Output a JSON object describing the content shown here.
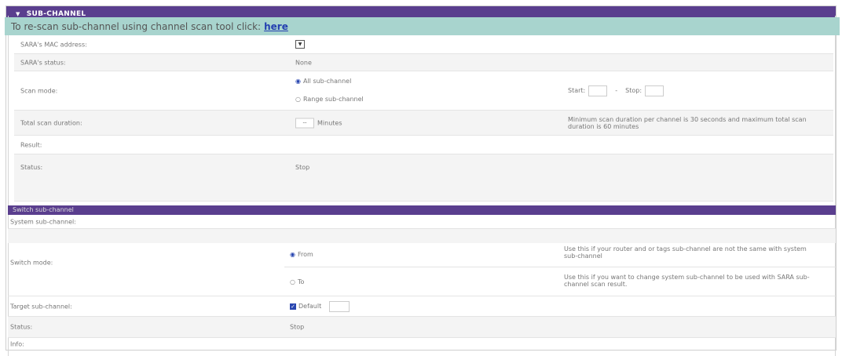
{
  "header": {
    "title": "SUB-CHANNEL"
  },
  "notice": {
    "text": "To re-scan sub-channel using channel scan tool click:",
    "link": "here"
  },
  "scan": {
    "mac_label": "SARA's MAC address:",
    "status_label": "SARA's status:",
    "status_value": "None",
    "mode_label": "Scan mode:",
    "mode_all": "All sub-channel",
    "mode_range": "Range sub-channel",
    "start_label": "Start:",
    "range_sep": "-",
    "stop_label": "Stop:",
    "duration_label": "Total scan duration:",
    "duration_value": "--",
    "duration_unit": "Minutes",
    "duration_note": "Minimum scan duration per channel is 30 seconds and maximum total scan duration is 60 minutes",
    "result_label": "Result:",
    "status2_label": "Status:",
    "status2_value": "Stop"
  },
  "switch": {
    "title": "Switch sub-channel",
    "system_label": "System sub-channel:",
    "mode_label": "Switch mode:",
    "from_label": "From",
    "from_note": "Use this if your router and or tags sub-channel are not the same with system sub-channel",
    "to_label": "To",
    "to_note": "Use this if you want to change system sub-channel to be used with SARA sub-channel scan result.",
    "target_label": "Target sub-channel:",
    "default_label": "Default",
    "status_label": "Status:",
    "status_value": "Stop",
    "info_label": "Info:"
  },
  "icons": {
    "collapse": "triangle-down-icon",
    "dropdown": "chevron-down-icon",
    "checkbox": "check-icon"
  },
  "colors": {
    "header": "#5a3e8e",
    "notice": "#a8d4ce",
    "link": "#2440b0",
    "radio": "#2a47b0"
  }
}
